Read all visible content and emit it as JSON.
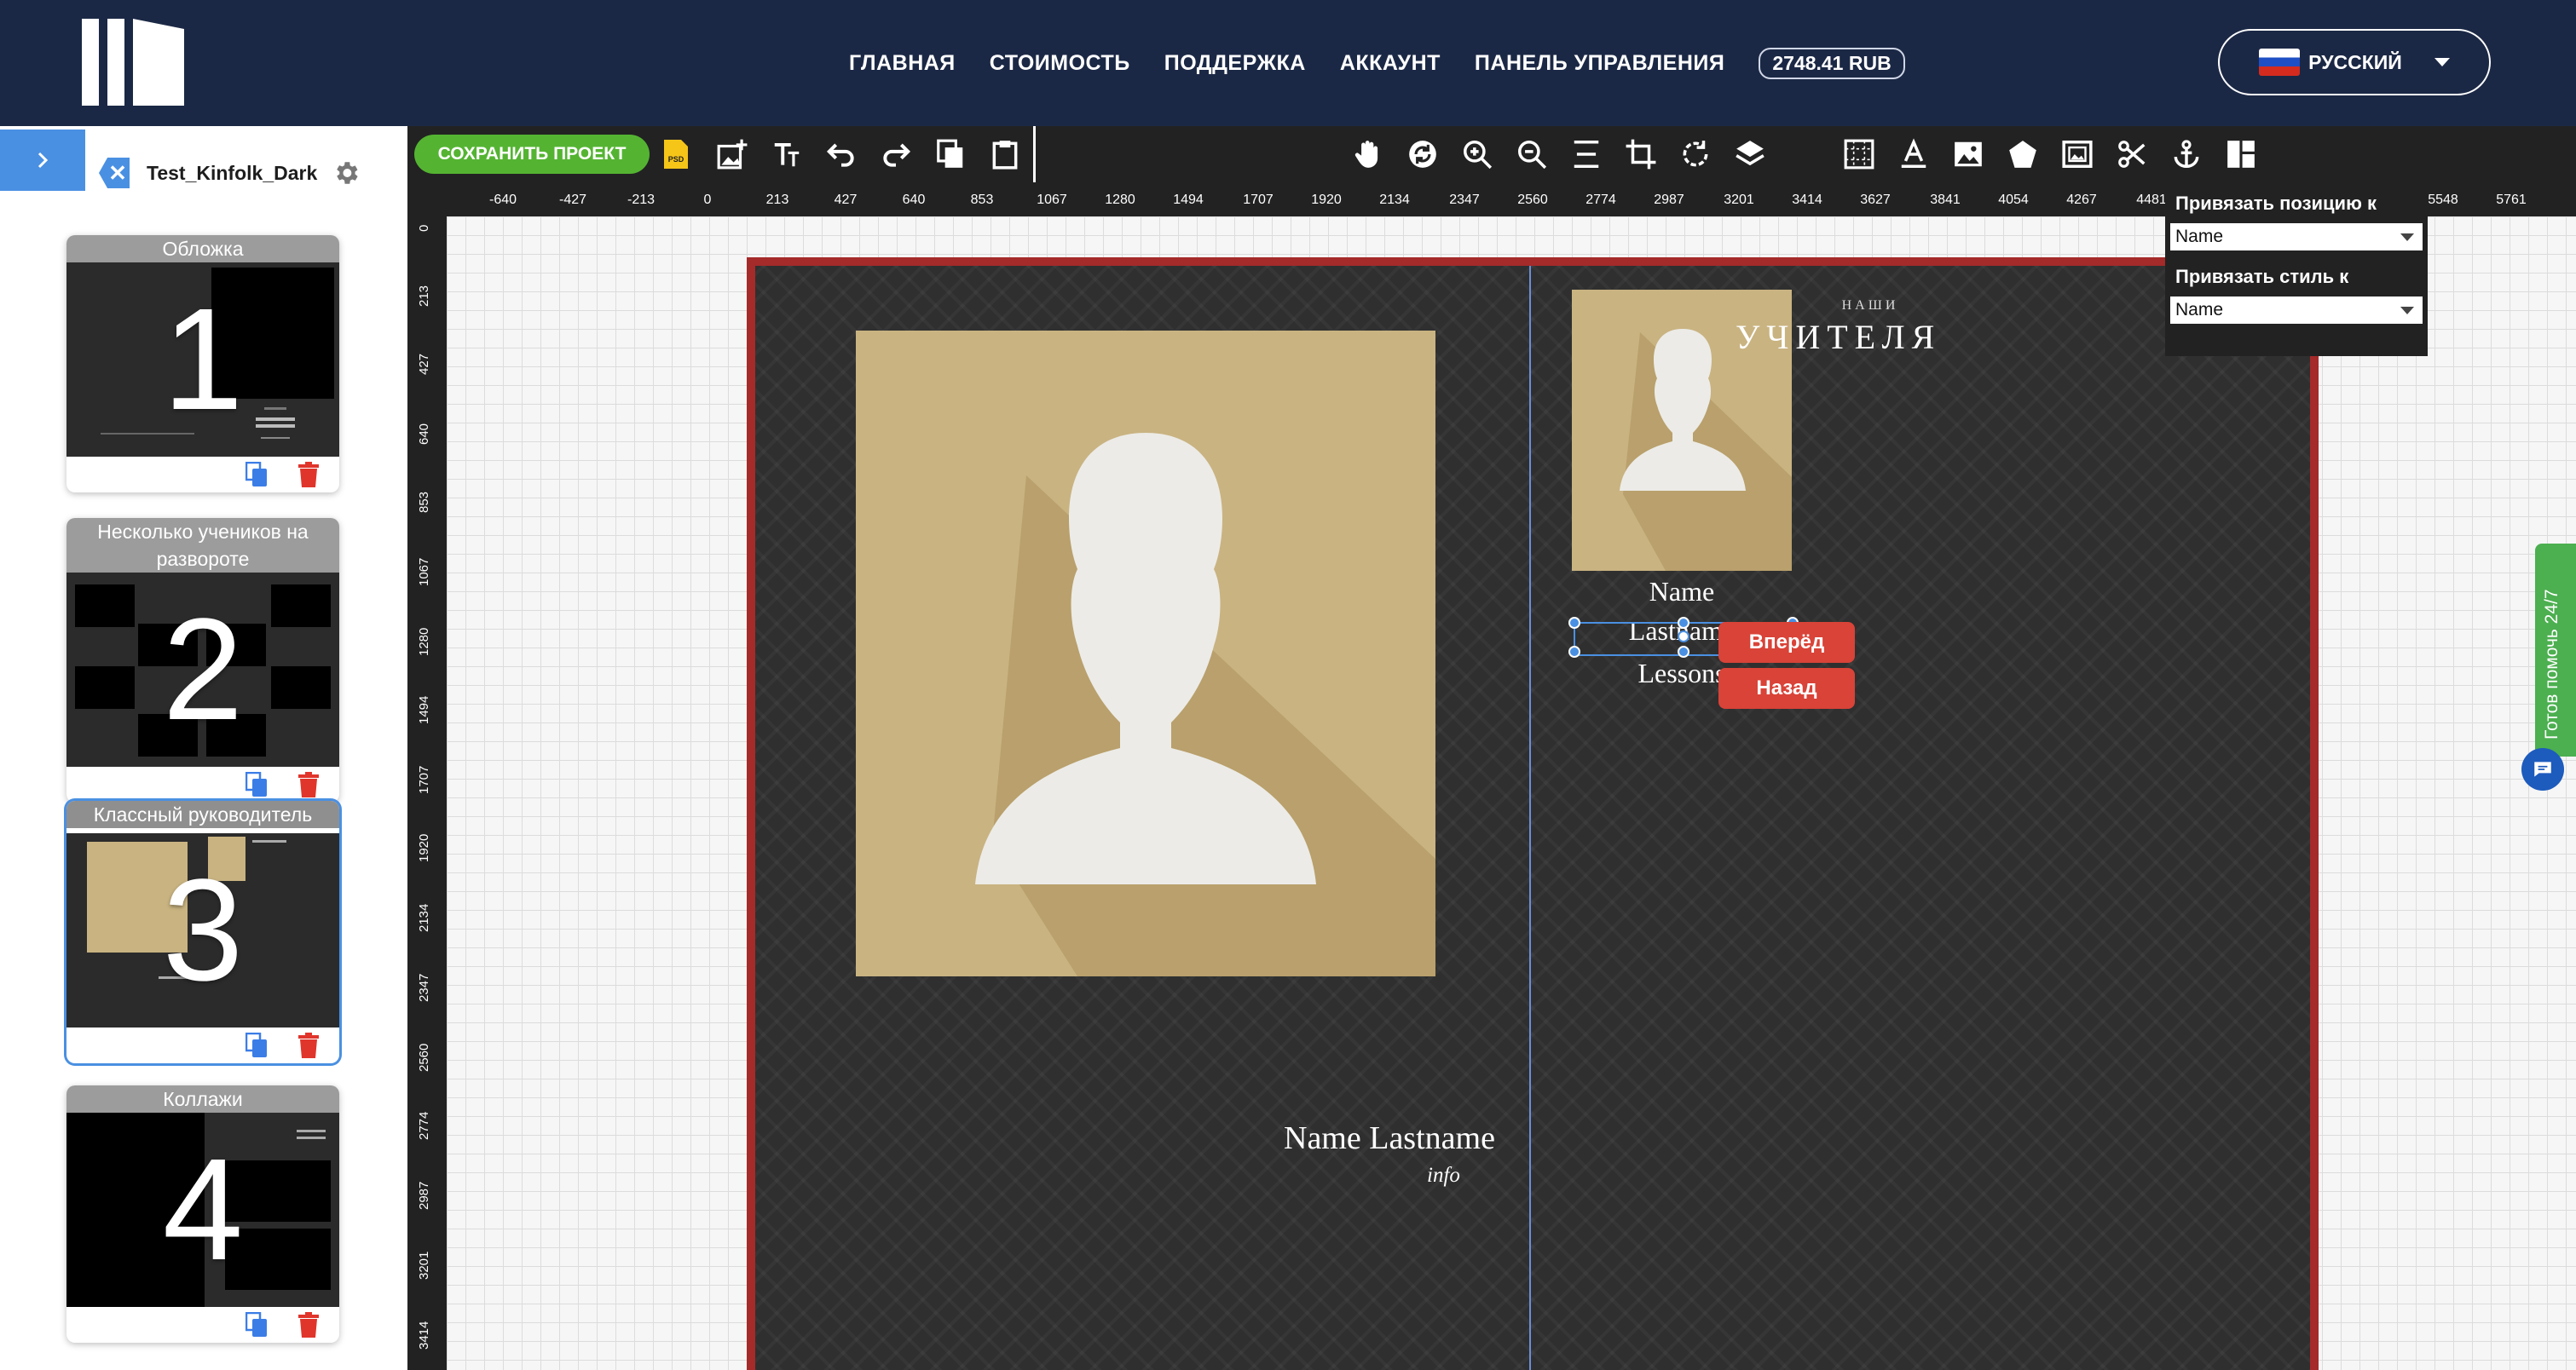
{
  "nav": {
    "items": [
      {
        "label": "ГЛАВНАЯ"
      },
      {
        "label": "СТОИМОСТЬ"
      },
      {
        "label": "ПОДДЕРЖКА"
      },
      {
        "label": "АККАУНТ"
      },
      {
        "label": "ПАНЕЛЬ УПРАВЛЕНИЯ"
      }
    ],
    "balance": "2748.41 RUB",
    "language": "РУССКИЙ"
  },
  "sidebar": {
    "toggle": ">",
    "project_name": "Test_Kinfolk_Dark",
    "pages": [
      {
        "title": "Обложка",
        "number": "1",
        "active": false
      },
      {
        "title": "Несколько учеников на развороте",
        "number": "2",
        "active": false
      },
      {
        "title": "Классный руководитель",
        "number": "3",
        "active": true
      },
      {
        "title": "Коллажи",
        "number": "4",
        "active": false
      }
    ]
  },
  "toolbar": {
    "save_label": "СОХРАНИТЬ ПРОЕКТ",
    "psd_label": "PSD",
    "left_icons": [
      "psd-icon",
      "add-image-icon",
      "add-text-icon",
      "undo-icon",
      "redo-icon",
      "copy-icon",
      "paste-icon"
    ],
    "right_icons": [
      "hand-icon",
      "rotate-view-icon",
      "zoom-in-icon",
      "zoom-out-icon",
      "align-icon",
      "crop-icon",
      "rotate-icon",
      "layers-icon",
      "moon-icon",
      "grid-icon",
      "text-color-icon",
      "image-icon",
      "pentagon-icon",
      "frame-icon",
      "scissors-icon",
      "anchor-icon",
      "layout-icon"
    ]
  },
  "rulers": {
    "top": [
      "-640",
      "-427",
      "-213",
      "0",
      "213",
      "427",
      "640",
      "853",
      "1067",
      "1280",
      "1494",
      "1707",
      "1920",
      "2134",
      "2347",
      "2560",
      "2774",
      "2987",
      "3201",
      "3414",
      "3627",
      "3841",
      "4054",
      "4267",
      "4481",
      "5548",
      "5761"
    ],
    "left": [
      "0",
      "213",
      "427",
      "640",
      "853",
      "1067",
      "1280",
      "1494",
      "1707",
      "1920",
      "2134",
      "2347",
      "2560",
      "2774",
      "2987",
      "3201",
      "3414"
    ]
  },
  "spread": {
    "name_lastname": "Name Lastname",
    "info": "info",
    "header_small": "НАШИ",
    "header_big": "УЧИТЕЛЯ",
    "teacher_name": "Name",
    "teacher_lastname": "Lastname",
    "teacher_lessons": "Lessons",
    "forward_button": "Вперёд",
    "back_button": "Назад"
  },
  "bind_panel": {
    "position_label": "Привязать позицию к",
    "position_value": "Name",
    "style_label": "Привязать стиль к",
    "style_value": "Name"
  },
  "help": {
    "label": "Готов помочь 24/7"
  },
  "colors": {
    "header_bg": "#1b2845",
    "save_green": "#54b432",
    "accent_blue": "#4a90e2",
    "spread_border": "#a52a2a",
    "photo_tan": "#c9b381",
    "button_red": "#d94338",
    "help_green": "#4caf50"
  }
}
